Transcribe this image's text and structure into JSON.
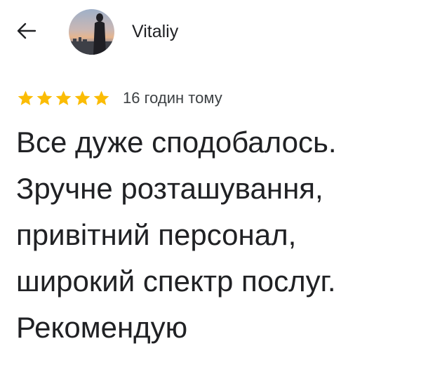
{
  "header": {
    "back_icon": "arrow-left-icon",
    "author_name": "Vitaliy"
  },
  "rating": {
    "stars": 5,
    "max_stars": 5,
    "star_color": "#fbbc04",
    "time_ago": "16 годин тому"
  },
  "review": {
    "lines": [
      "Все дуже сподобалось.",
      "Зручне розташування,",
      "привітний персонал,",
      "широкий спектр послуг.",
      "Рекомендую"
    ]
  }
}
